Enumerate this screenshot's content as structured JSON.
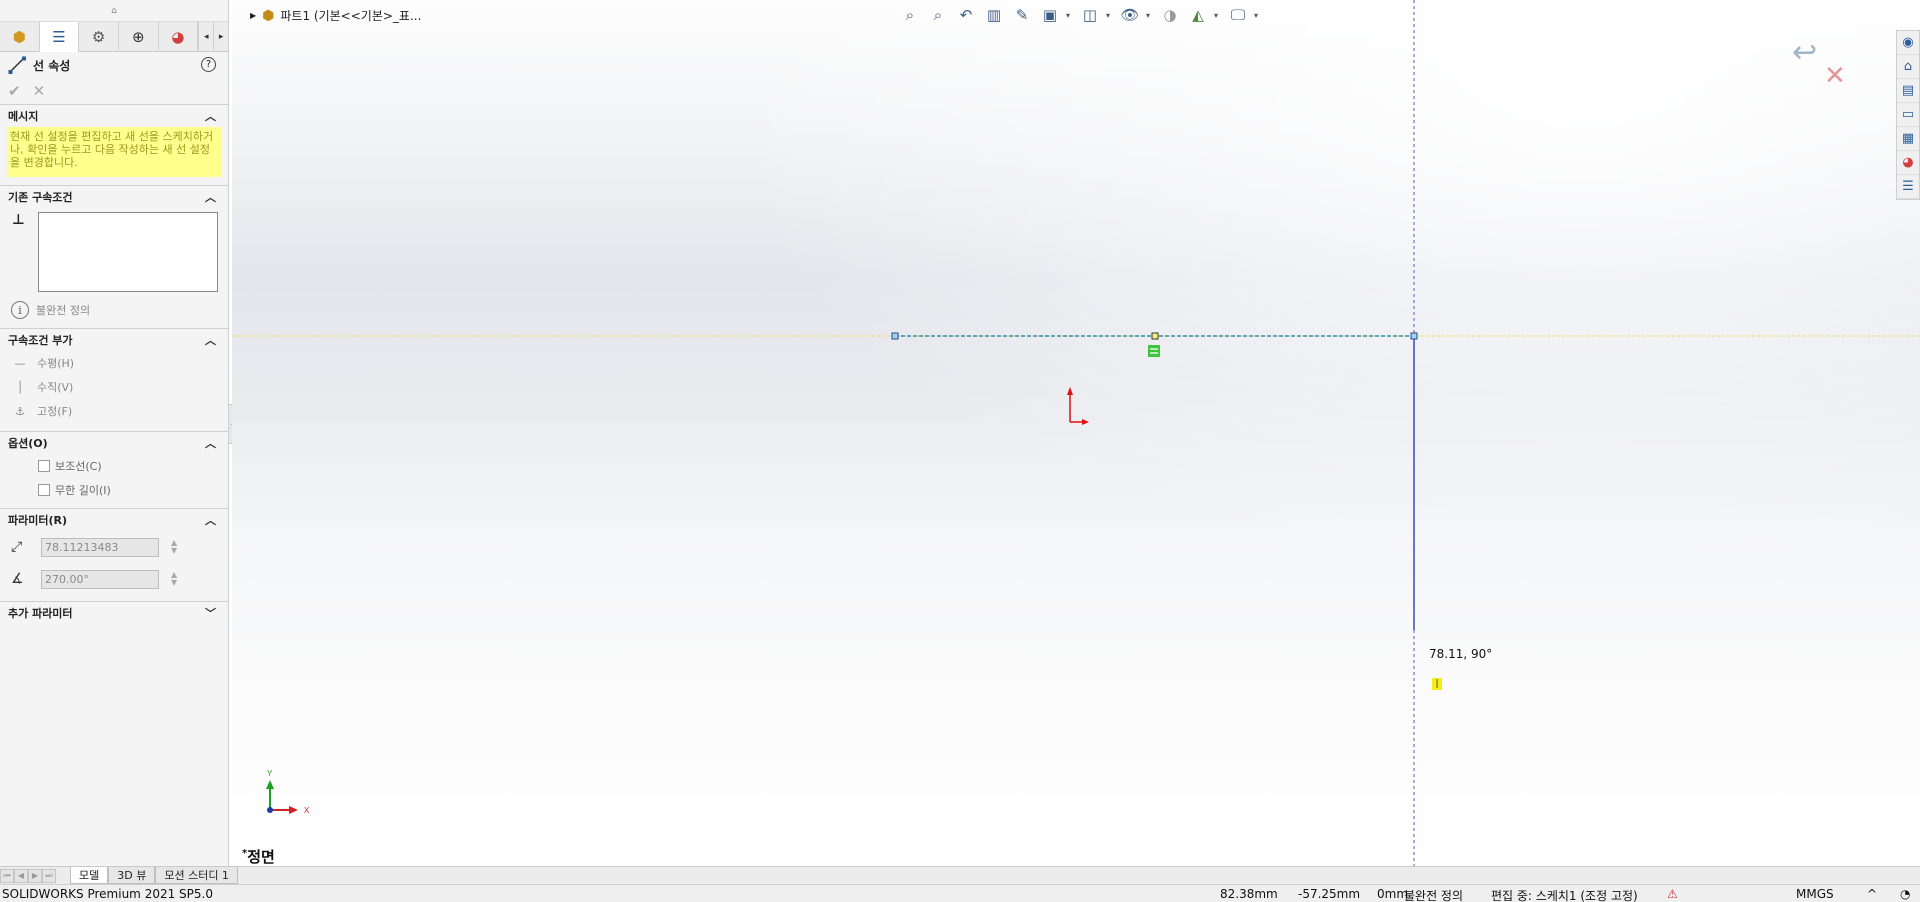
{
  "panel": {
    "title": "선 속성",
    "tabs": [
      {
        "icon": "feature-manager-icon"
      },
      {
        "icon": "property-manager-icon"
      },
      {
        "icon": "configuration-manager-icon"
      },
      {
        "icon": "dimxpert-manager-icon"
      },
      {
        "icon": "display-manager-icon"
      }
    ],
    "sections": {
      "message": {
        "heading": "메시지",
        "text": "현재 선 설정을 편집하고 새 선을 스케치하거나, 확인을 누르고 다음 작성하는 새 선 설정을 변경합니다."
      },
      "existing_relations": {
        "heading": "기존 구속조건",
        "status": "불완전 정의"
      },
      "add_relations": {
        "heading": "구속조건 부가",
        "horizontal": "수평(H)",
        "vertical": "수직(V)",
        "fix": "고정(F)"
      },
      "options": {
        "heading": "옵션(O)",
        "construction": "보조선(C)",
        "infinite_length": "무한 길이(I)"
      },
      "parameters": {
        "heading": "파라미터(R)",
        "length": "78.11213483",
        "angle": "270.00°"
      },
      "additional_parameters": {
        "heading": "추가 파라미터"
      }
    }
  },
  "graphics": {
    "breadcrumb": "파트1  (기본<<기본>_표...",
    "view_name": "정면",
    "view_prefix": "*",
    "dimension_readout": "78.11, 90°",
    "triad_x": "X",
    "triad_y": "Y"
  },
  "bottom_tabs": [
    "모델",
    "3D 뷰",
    "모션 스터디 1"
  ],
  "status_bar": {
    "app": "SOLIDWORKS Premium 2021 SP5.0",
    "x": "82.38mm",
    "y": "-57.25mm",
    "z": "0mm",
    "definition": "불완전 정의",
    "editing": "편집 중: 스케치1 (조정 고정)",
    "units": "MMGS",
    "units_arrow": "^"
  },
  "colors": {
    "accent": "#2a5d9a",
    "message_bg": "#ffff8e",
    "sketch_line": "#2f8fb0",
    "inference_line": "#f0e060"
  }
}
